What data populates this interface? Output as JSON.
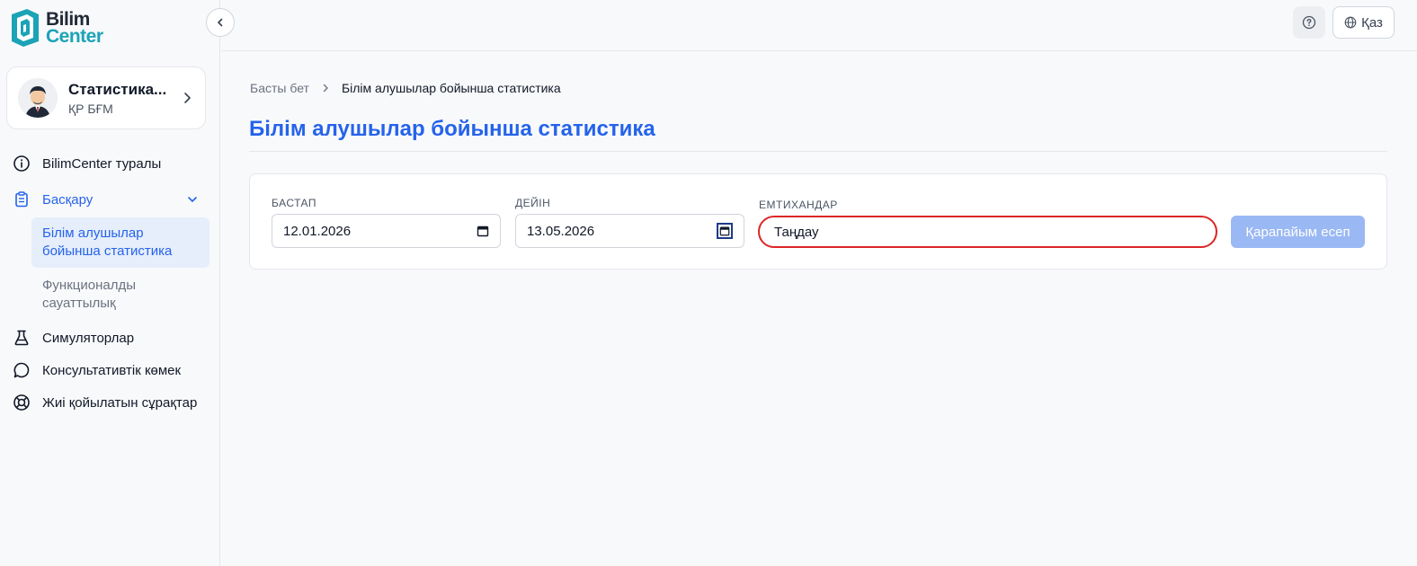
{
  "app": {
    "logo_line1": "Bilim",
    "logo_line2": "Center"
  },
  "profile": {
    "name": "Статистика...",
    "org": "ҚР БҒМ"
  },
  "sidebar": {
    "items": [
      {
        "label": "BilimCenter туралы",
        "icon": "info-icon"
      },
      {
        "label": "Басқару",
        "icon": "clipboard-icon",
        "expanded": true
      },
      {
        "label": "Симуляторлар",
        "icon": "flask-icon"
      },
      {
        "label": "Консультативтік көмек",
        "icon": "chat-bubble-icon"
      },
      {
        "label": "Жиі қойылатын сұрақтар",
        "icon": "lifebuoy-icon"
      }
    ],
    "subitems": [
      {
        "label": "Білім алушылар бойынша статистика",
        "selected": true
      },
      {
        "label": "Функционалды сауаттылық",
        "selected": false
      }
    ]
  },
  "topbar": {
    "lang_label": "Қаз"
  },
  "breadcrumb": {
    "home": "Басты бет",
    "current": "Білім алушылар бойынша статистика"
  },
  "page": {
    "title": "Білім алушылар бойынша статистика"
  },
  "filters": {
    "from_label": "БАСТАП",
    "from_value": "12.01.2026",
    "to_label": "ДЕЙІН",
    "to_value": "13.05.2026",
    "exams_label": "ЕМТИХАНДАР",
    "exams_placeholder": "Таңдау",
    "submit_label": "Қарапайым есеп"
  },
  "colors": {
    "accent": "#2563eb",
    "logo_teal": "#1ba3b6",
    "error_border": "#dc2626",
    "button_disabled": "#9ab8f3"
  }
}
